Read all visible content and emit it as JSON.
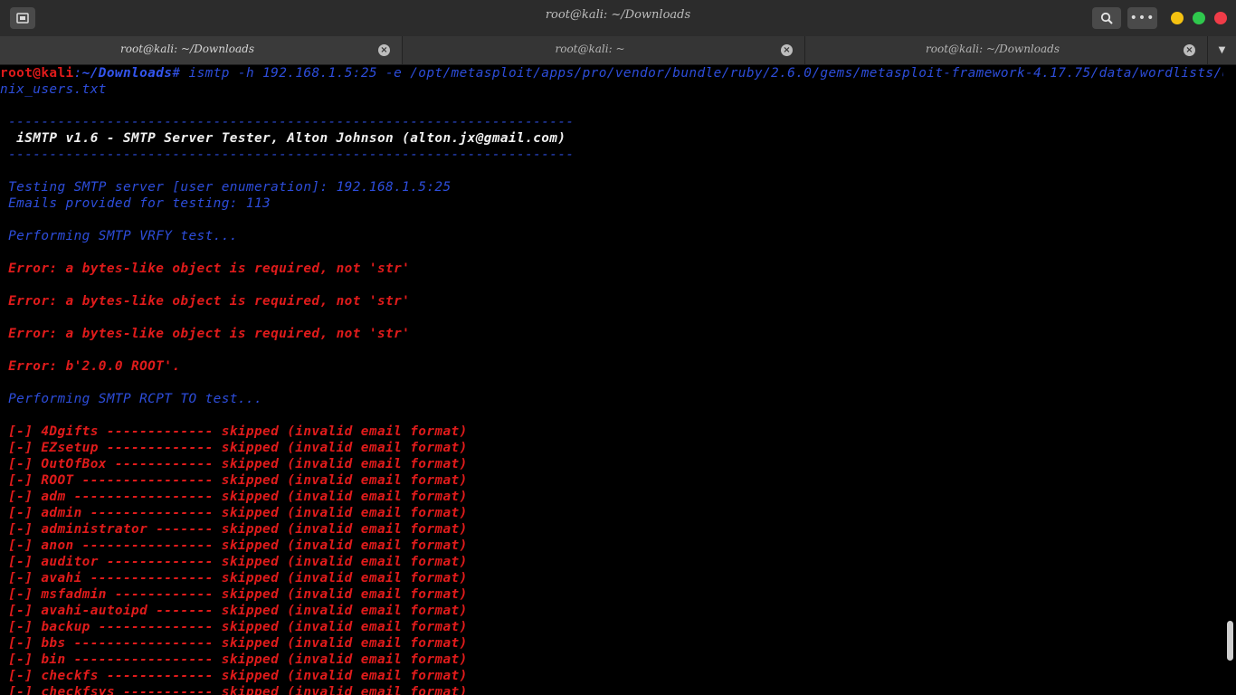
{
  "window": {
    "title": "root@kali: ~/Downloads",
    "new_tab_icon": "new-tab-icon",
    "search_icon": "search-icon",
    "menu_label": "•••"
  },
  "tabs": [
    {
      "label": "root@kali: ~/Downloads",
      "active": true
    },
    {
      "label": "root@kali: ~",
      "active": false
    },
    {
      "label": "root@kali: ~/Downloads",
      "active": false
    }
  ],
  "tab_close_glyph": "×",
  "tab_overflow_glyph": "▼",
  "prompt": {
    "user_host": "root@kali",
    "sep": ":",
    "path": "~/Downloads",
    "symbol": "#",
    "command_1": " ismtp -h 192.168.1.5:25 -e /opt/metasploit/apps/pro/vendor/bundle/ruby/2.6.0/gems/metasploit-framework-4.17.75/data/wordlists/u",
    "command_2": "nix_users.txt"
  },
  "output": {
    "divider": " ---------------------------------------------------------------------",
    "banner": "  iSMTP v1.6 - SMTP Server Tester, Alton Johnson (alton.jx@gmail.com)",
    "testing": " Testing SMTP server [user enumeration]: 192.168.1.5:25",
    "emails": " Emails provided for testing: 113",
    "vrfy": " Performing SMTP VRFY test...",
    "error_bytes": " Error: a bytes-like object is required, not 'str'",
    "error_root": " Error: b'2.0.0 ROOT'.",
    "rcpt": " Performing SMTP RCPT TO test...",
    "results": [
      " [-] 4Dgifts ------------- skipped (invalid email format)",
      " [-] EZsetup ------------- skipped (invalid email format)",
      " [-] OutOfBox ------------ skipped (invalid email format)",
      " [-] ROOT ---------------- skipped (invalid email format)",
      " [-] adm ----------------- skipped (invalid email format)",
      " [-] admin --------------- skipped (invalid email format)",
      " [-] administrator ------- skipped (invalid email format)",
      " [-] anon ---------------- skipped (invalid email format)",
      " [-] auditor ------------- skipped (invalid email format)",
      " [-] avahi --------------- skipped (invalid email format)",
      " [-] msfadmin ------------ skipped (invalid email format)",
      " [-] avahi-autoipd ------- skipped (invalid email format)",
      " [-] backup -------------- skipped (invalid email format)",
      " [-] bbs ----------------- skipped (invalid email format)",
      " [-] bin ----------------- skipped (invalid email format)",
      " [-] checkfs ------------- skipped (invalid email format)",
      " [-] checkfsys ----------- skipped (invalid email format)"
    ]
  },
  "colors": {
    "background": "#000000",
    "prompt_user": "#e01b1b",
    "prompt_path": "#3355ee",
    "output_blue": "#2d4ddb",
    "output_red": "#e01b1b",
    "dot_minimize": "#f5c211",
    "dot_maximize": "#2fc84d",
    "dot_close": "#f03c48"
  }
}
